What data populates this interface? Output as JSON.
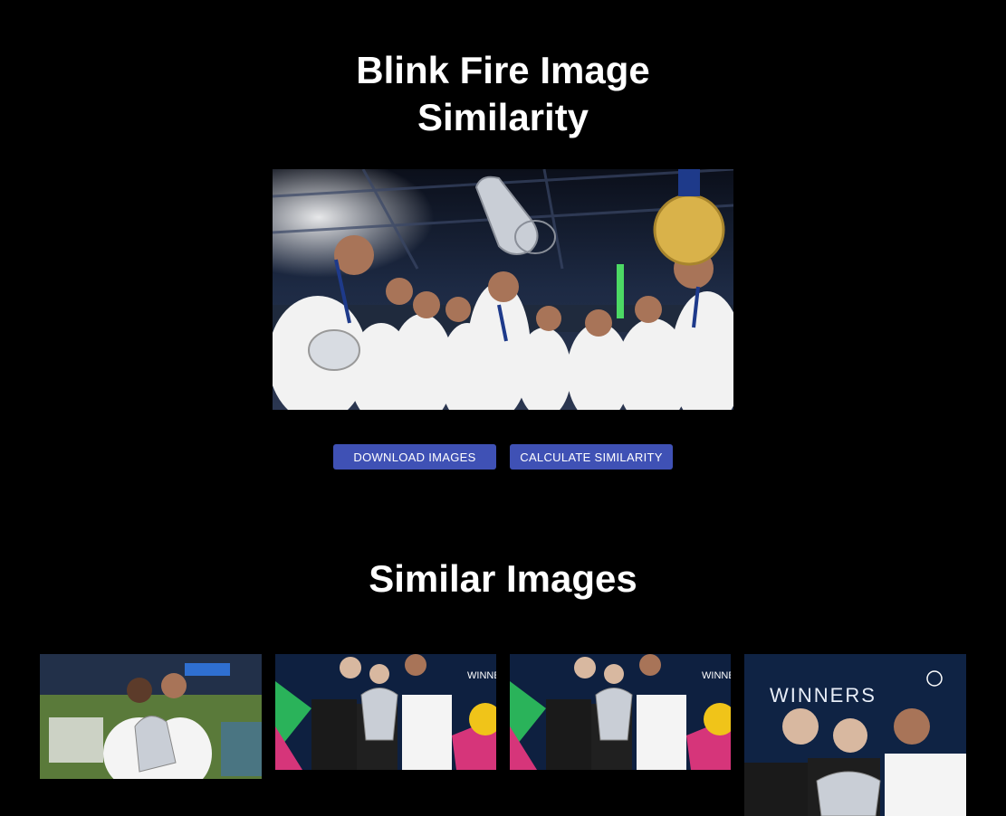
{
  "page": {
    "title_line1": "Blink Fire Image",
    "title_line2": "Similarity"
  },
  "query_image": {
    "alt": "Players celebrating with trophy"
  },
  "actions": {
    "download_label": "DOWNLOAD IMAGES",
    "calculate_label": "CALCULATE SIMILARITY"
  },
  "results": {
    "heading": "Similar Images",
    "images": [
      {
        "alt": "Two players celebrating with trophy on pitch",
        "banner_text": ""
      },
      {
        "alt": "Three men posing with trophy",
        "banner_text": "WINNER"
      },
      {
        "alt": "Three men posing with trophy",
        "banner_text": "WINNER"
      },
      {
        "alt": "Three men posing with trophy in front of winners board",
        "banner_text": "WINNERS"
      }
    ]
  },
  "colors": {
    "background": "#000000",
    "button": "#3f51b5",
    "text": "#ffffff"
  }
}
